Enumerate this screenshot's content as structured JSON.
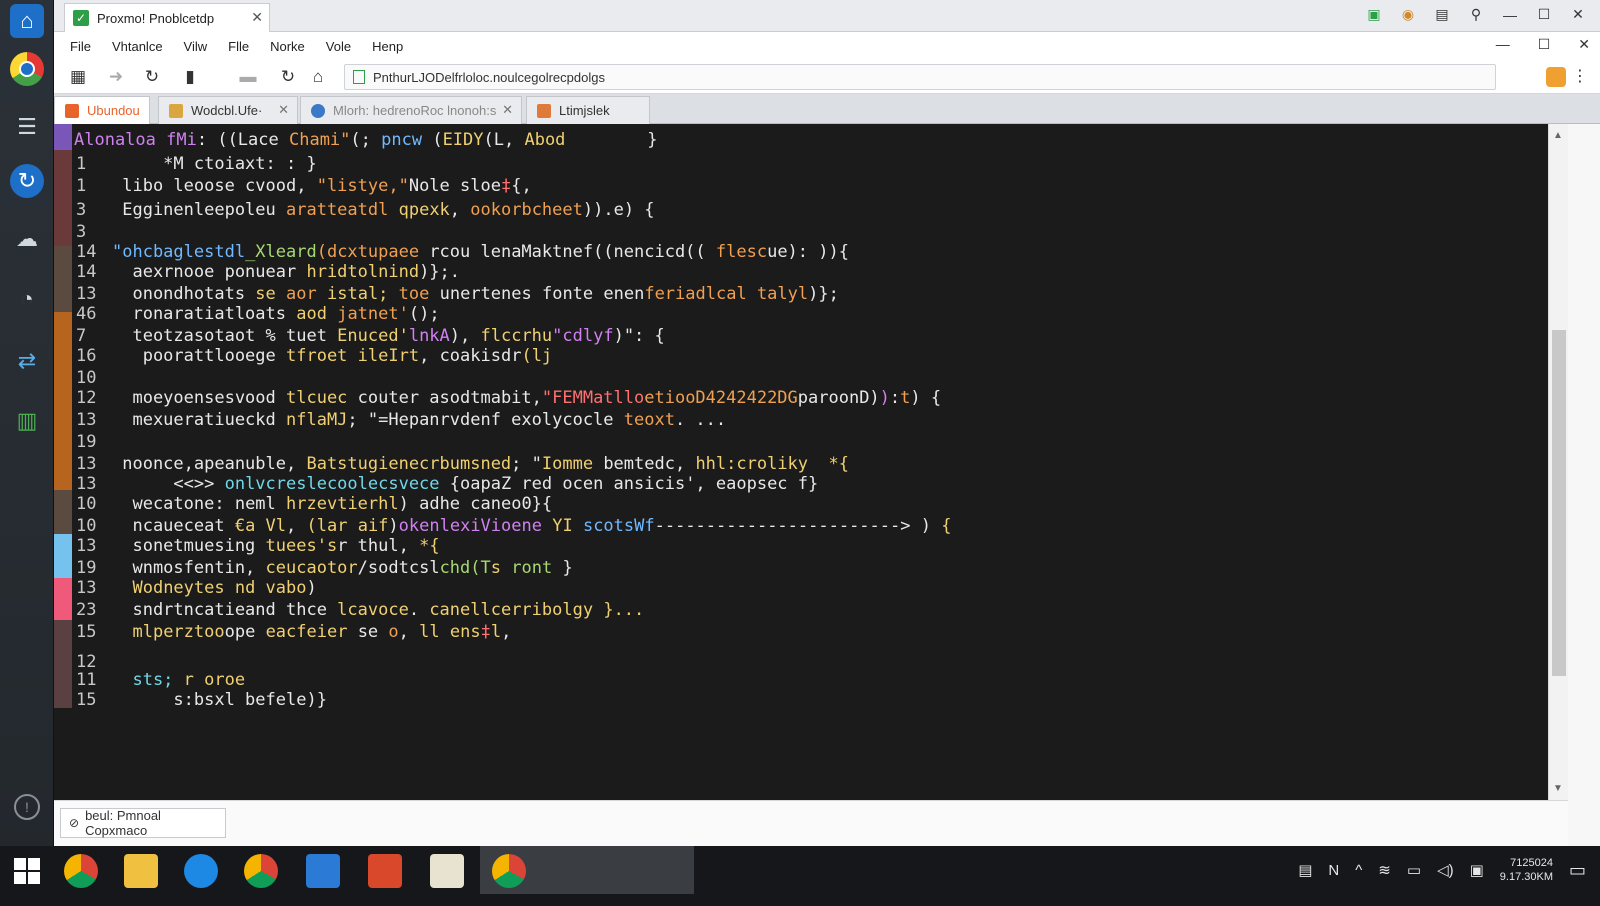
{
  "window": {
    "title": "Proxmo! Pnoblcetdp"
  },
  "menu": [
    "File",
    "Vhtanlce",
    "Vilw",
    "Flle",
    "Norke",
    "Vole",
    "Henp"
  ],
  "toolbar": {
    "address": "PnthurLJODelfrloloc.noulcegolrecpdolgs"
  },
  "tabs": [
    {
      "label": "Ubundou",
      "color": "#e8642c",
      "active": true
    },
    {
      "label": "Wodcbl.Ufe·",
      "color": "#d9a640",
      "active": false
    },
    {
      "label": "Mlorh: hedrenoRoc lnonoh:s",
      "color": "#3b78c7",
      "active": false
    },
    {
      "label": "Ltimjslek",
      "color": "#e07a3a",
      "active": false
    }
  ],
  "code_lines": [
    {
      "ln": "",
      "parts": [
        [
          "p",
          "Alonaloa"
        ],
        [
          "w",
          " "
        ],
        [
          "p",
          "fMi"
        ],
        [
          "w",
          ": ((Lace "
        ],
        [
          "o",
          "Chami\""
        ],
        [
          "w",
          "(; "
        ],
        [
          "b",
          "pncw"
        ],
        [
          "w",
          " ("
        ],
        [
          "y",
          "EIDY"
        ],
        [
          "w",
          "(L, "
        ],
        [
          "y",
          "Abod"
        ],
        [
          "w",
          "        }"
        ]
      ]
    },
    {
      "ln": "1",
      "parts": [
        [
          "w",
          "     *M ctoiaxt: : }"
        ]
      ]
    },
    {
      "ln": "1",
      "parts": [
        [
          "w",
          " libo leoose cvood, "
        ],
        [
          "o",
          "\"listye,\""
        ],
        [
          "w",
          "Nole "
        ],
        [
          "w",
          "sloe"
        ],
        [
          "r",
          "‡"
        ],
        [
          "w",
          "{,"
        ]
      ]
    },
    {
      "ln": "3",
      "parts": [
        [
          "w",
          " Egginenleepoleu "
        ],
        [
          "o",
          "aratteatdl"
        ],
        [
          "w",
          " "
        ],
        [
          "y",
          "qpexk"
        ],
        [
          "w",
          ", "
        ],
        [
          "o",
          "ookorbcheet"
        ],
        [
          "w",
          ")).e) {"
        ]
      ]
    },
    {
      "ln": "3",
      "parts": [
        [
          "w",
          ""
        ]
      ]
    },
    {
      "ln": "14",
      "parts": [
        [
          "b",
          "\"ohcbaglestdl"
        ],
        [
          "g",
          "_Xleard"
        ],
        [
          "o",
          "(dcxtupaee"
        ],
        [
          "w",
          " rcou lenaMaktnef((nencicd(( "
        ],
        [
          "o",
          "flesc"
        ],
        [
          "w",
          "ue): )){"
        ]
      ]
    },
    {
      "ln": "14",
      "parts": [
        [
          "w",
          "  aexrnooe ponuear "
        ],
        [
          "y",
          "hridtolnind"
        ],
        [
          "w",
          ")};."
        ]
      ]
    },
    {
      "ln": "13",
      "parts": [
        [
          "w",
          "  onondhotats "
        ],
        [
          "y",
          "se"
        ],
        [
          "w",
          " "
        ],
        [
          "o",
          "aor"
        ],
        [
          "w",
          " "
        ],
        [
          "y",
          "istal;"
        ],
        [
          "w",
          " "
        ],
        [
          "o",
          "toe"
        ],
        [
          "w",
          " unertenes fonte enen"
        ],
        [
          "o",
          "feriadlcal"
        ],
        [
          "w",
          " "
        ],
        [
          "o",
          "talyl"
        ],
        [
          "w",
          ")};"
        ]
      ]
    },
    {
      "ln": "46",
      "parts": [
        [
          "w",
          "  ronaratiatloats "
        ],
        [
          "y",
          "aod"
        ],
        [
          "w",
          " "
        ],
        [
          "o",
          "jatnet'"
        ],
        [
          "w",
          "();"
        ]
      ]
    },
    {
      "ln": "7",
      "parts": [
        [
          "w",
          "  teotzasotaot % tuet "
        ],
        [
          "y",
          "Enuced'"
        ],
        [
          "p",
          "lnkA"
        ],
        [
          "w",
          "), "
        ],
        [
          "y",
          "flccrhu"
        ],
        [
          "p",
          "\"cdlyf"
        ],
        [
          "w",
          ")\": {"
        ]
      ]
    },
    {
      "ln": "16",
      "parts": [
        [
          "w",
          "   poorattlooege "
        ],
        [
          "y",
          "tfroet"
        ],
        [
          "w",
          " "
        ],
        [
          "y",
          "ileIrt"
        ],
        [
          "w",
          ", coakisdr"
        ],
        [
          "y",
          "(lj"
        ]
      ]
    },
    {
      "ln": "10",
      "parts": [
        [
          "w",
          ""
        ]
      ]
    },
    {
      "ln": "12",
      "parts": [
        [
          "w",
          "  moeyoensesvood "
        ],
        [
          "y",
          "tlcuec"
        ],
        [
          "w",
          " couter asodtmabit,"
        ],
        [
          "r",
          "\"FEMMatllo"
        ],
        [
          "o",
          "etiooD4242422DG"
        ],
        [
          "w",
          "paroonD)"
        ],
        [
          "p",
          ")"
        ],
        [
          "w",
          ":"
        ],
        [
          "o",
          "t"
        ],
        [
          "w",
          ") {"
        ]
      ]
    },
    {
      "ln": "13",
      "parts": [
        [
          "w",
          "  mexueratiueckd "
        ],
        [
          "y",
          "nflaMJ"
        ],
        [
          "w",
          "; \"=Hepanrvdenf exolycocle "
        ],
        [
          "o",
          "teoxt"
        ],
        [
          "w",
          ". ..."
        ]
      ]
    },
    {
      "ln": "19",
      "parts": [
        [
          "w",
          ""
        ]
      ]
    },
    {
      "ln": "13",
      "parts": [
        [
          "w",
          " noonce,apeanuble, "
        ],
        [
          "y",
          "Batstugienecrbumsned"
        ],
        [
          "w",
          "; \""
        ],
        [
          "y",
          "Iomme"
        ],
        [
          "w",
          " bemtedc, "
        ],
        [
          "y",
          "hhl:croliky"
        ],
        [
          "w",
          "  "
        ],
        [
          "y",
          "*{"
        ]
      ]
    },
    {
      "ln": "13",
      "parts": [
        [
          "w",
          "      <<>> "
        ],
        [
          "c",
          "onlvcreslecoolecsvece"
        ],
        [
          "w",
          " {oapaZ "
        ],
        [
          "w",
          "red"
        ],
        [
          "w",
          " ocen ansicis', eaopsec f}"
        ]
      ]
    },
    {
      "ln": "10",
      "parts": [
        [
          "w",
          "  wecatone: "
        ],
        [
          "w",
          "neml"
        ],
        [
          "w",
          " "
        ],
        [
          "y",
          "hrzevtierhl"
        ],
        [
          "w",
          ") adhe caneo0}{"
        ]
      ]
    },
    {
      "ln": "10",
      "parts": [
        [
          "w",
          "  ncaueceat "
        ],
        [
          "y",
          "€a Vl"
        ],
        [
          "w",
          ", "
        ],
        [
          "y",
          "(lar"
        ],
        [
          "w",
          " "
        ],
        [
          "y",
          "aif"
        ],
        [
          "w",
          ")"
        ],
        [
          "p",
          "okenlexiVioene"
        ],
        [
          "w",
          " "
        ],
        [
          "y",
          "YI"
        ],
        [
          "w",
          " "
        ],
        [
          "b",
          "scotsWf"
        ],
        [
          "w",
          "------------------------> ) "
        ],
        [
          "y",
          "{"
        ]
      ]
    },
    {
      "ln": "13",
      "parts": [
        [
          "w",
          "  sonetmuesing "
        ],
        [
          "y",
          "tuees's"
        ],
        [
          "w",
          "r thul, "
        ],
        [
          "y",
          "*{"
        ]
      ]
    },
    {
      "ln": "19",
      "parts": [
        [
          "w",
          "  wnmosfentin, "
        ],
        [
          "y",
          "ceucaotor"
        ],
        [
          "w",
          "/sodt"
        ],
        [
          "w",
          "csl"
        ],
        [
          "g",
          "chd(T"
        ],
        [
          "y",
          "s"
        ],
        [
          "w",
          " "
        ],
        [
          "g",
          "ront"
        ],
        [
          "w",
          " }"
        ]
      ]
    },
    {
      "ln": "13",
      "parts": [
        [
          "w",
          "  "
        ],
        [
          "y",
          "Wodneytes nd vabo"
        ],
        [
          "w",
          ")"
        ]
      ]
    },
    {
      "ln": "23",
      "parts": [
        [
          "w",
          "  sndrtncatieand thce "
        ],
        [
          "y",
          "lcavoce"
        ],
        [
          "w",
          ". "
        ],
        [
          "y",
          "canellcerribolgy"
        ],
        [
          "w",
          " "
        ],
        [
          "y",
          "}..."
        ]
      ]
    },
    {
      "ln": "15",
      "parts": [
        [
          "w",
          "  "
        ],
        [
          "y",
          "mlperztoo"
        ],
        [
          "w",
          "ope "
        ],
        [
          "y",
          "eacfeier"
        ],
        [
          "w",
          " se "
        ],
        [
          "o",
          "o"
        ],
        [
          "w",
          ", "
        ],
        [
          "y",
          "ll ens"
        ],
        [
          "r",
          "‡"
        ],
        [
          "y",
          "l"
        ],
        [
          "w",
          ","
        ]
      ]
    },
    {
      "ln": "12",
      "parts": [
        [
          "w",
          ""
        ]
      ]
    },
    {
      "ln": "11",
      "parts": [
        [
          "c",
          "  sts;"
        ],
        [
          "w",
          " "
        ],
        [
          "y",
          "r oroe"
        ]
      ]
    },
    {
      "ln": "15",
      "parts": [
        [
          "w",
          "      s:bsxl befele)}"
        ]
      ]
    }
  ],
  "status": {
    "label": "beul: Pmnoal Copxmaco"
  },
  "taskbar": {
    "clock_time": "7125024",
    "clock_date": "9.17.30KM"
  }
}
